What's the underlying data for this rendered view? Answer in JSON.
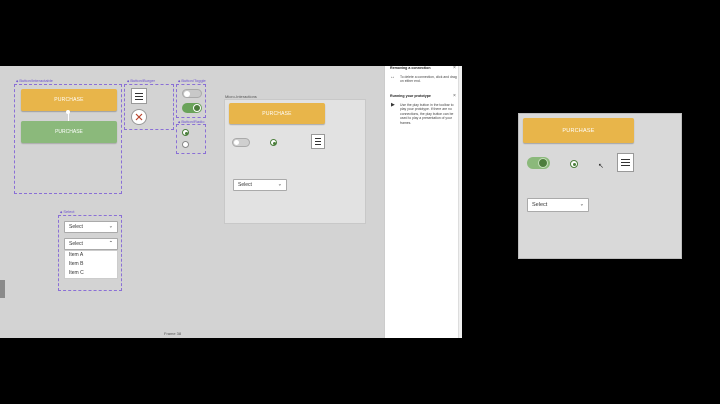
{
  "canvas": {
    "frame_button_interactable": {
      "label": "Button/Interactable",
      "primary": "PURCHASE",
      "secondary": "PURCHASE"
    },
    "frame_button_burger": {
      "label": "Button/Burger"
    },
    "frame_button_toggle": {
      "label": "Button/Toggle"
    },
    "frame_button_radio": {
      "label": "Button/Radio"
    },
    "frame_select": {
      "label": "Select",
      "value": "Select",
      "open_value": "Select",
      "items": [
        "Item A",
        "Item B",
        "Item C"
      ]
    },
    "micro_interactions": {
      "label": "Micro-Interactions",
      "purchase": "PURCHASE",
      "select": "Select"
    },
    "footer_label": "Frame 38"
  },
  "help_panel": {
    "section1": {
      "title": "Removing a connection",
      "text": "To delete a connection, click and drag on either end."
    },
    "section2": {
      "title": "Running your prototype",
      "text": "Use the play button in the toolbar to play your prototype. If there are no connections, the play button can be used to play a presentation of your frames."
    }
  },
  "preview": {
    "purchase": "PURCHASE",
    "select": "Select"
  },
  "colors": {
    "accent_yellow": "#e8b54a",
    "accent_green": "#8bb97b",
    "toggle_on": "#6aa35a",
    "selection_purple": "#8a6fd6"
  },
  "icons": [
    "burger-menu-icon",
    "close-circle-icon",
    "chevron-down-icon",
    "close-icon",
    "connection-icon",
    "play-icon",
    "cursor-icon"
  ]
}
